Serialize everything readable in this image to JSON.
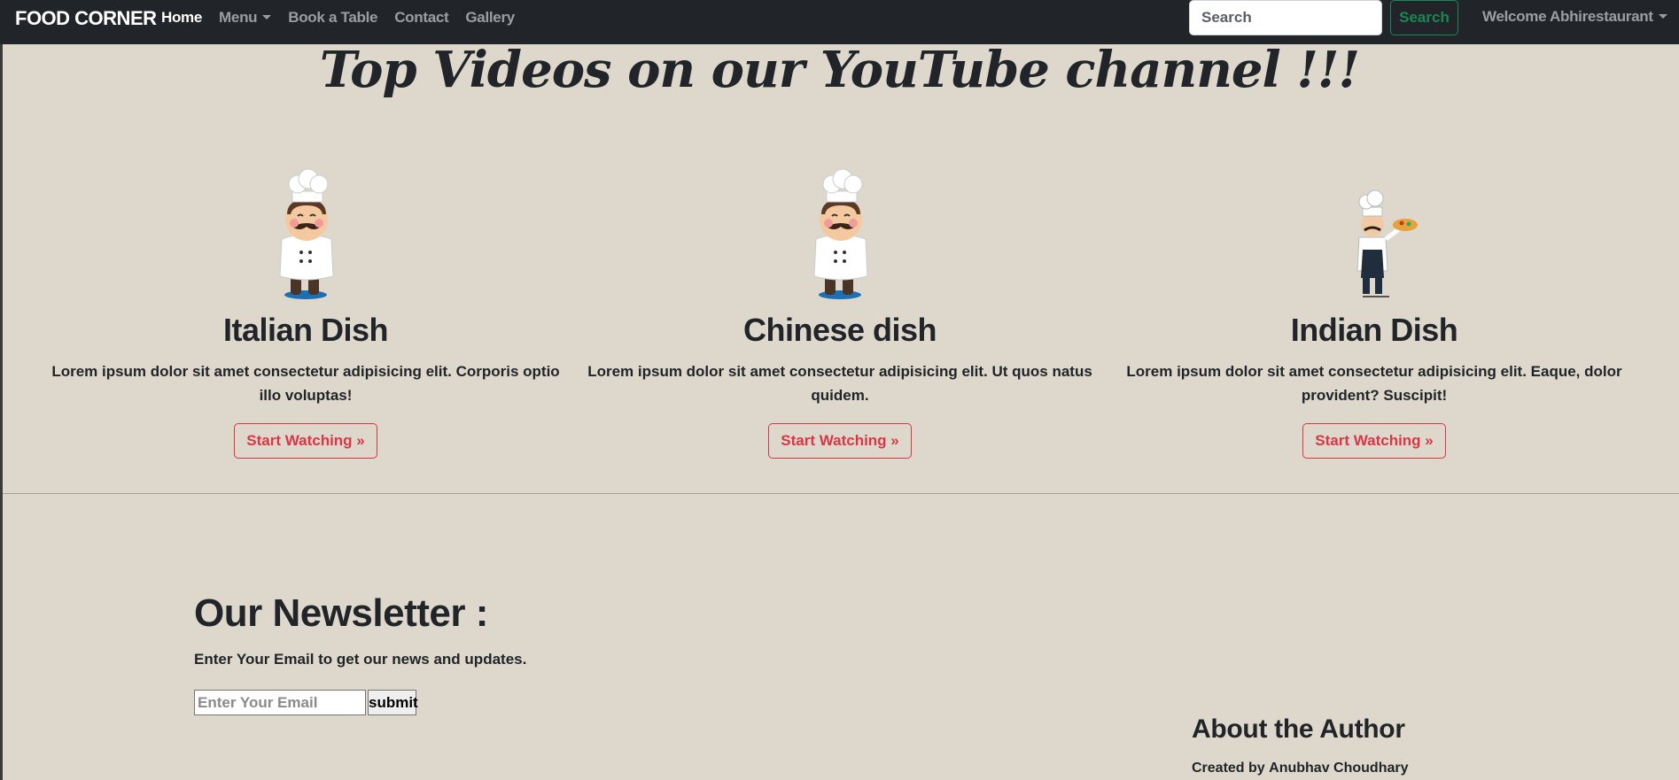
{
  "navbar": {
    "brand": "FOOD CORNER",
    "links": [
      {
        "label": "Home",
        "active": true
      },
      {
        "label": "Menu",
        "dropdown": true
      },
      {
        "label": "Book a Table"
      },
      {
        "label": "Contact"
      },
      {
        "label": "Gallery"
      }
    ],
    "search_placeholder": "Search",
    "search_button": "Search",
    "welcome": "Welcome Abhirestaurant"
  },
  "heading": "Top Videos on our YouTube channel !!!",
  "cards": [
    {
      "icon": "chef-mustache-icon",
      "title": "Italian Dish",
      "text": "Lorem ipsum dolor sit amet consectetur adipisicing elit. Corporis optio illo voluptas!",
      "button": "Start Watching »"
    },
    {
      "icon": "chef-mustache-icon",
      "title": "Chinese dish",
      "text": "Lorem ipsum dolor sit amet consectetur adipisicing elit. Ut quos natus quidem.",
      "button": "Start Watching »"
    },
    {
      "icon": "chef-pizza-icon",
      "title": "Indian Dish",
      "text": "Lorem ipsum dolor sit amet consectetur adipisicing elit. Eaque, dolor provident? Suscipit!",
      "button": "Start Watching »"
    }
  ],
  "newsletter": {
    "title": "Our Newsletter :",
    "text": "Enter Your Email to get our news and updates.",
    "input_placeholder": "Enter Your Email",
    "submit": "submit"
  },
  "about": {
    "title": "About the Author",
    "created_by": "Created by",
    "author": "Anubhav Choudhary"
  },
  "colors": {
    "navbar_bg": "#212529",
    "page_bg": "#ded8cc",
    "success": "#198754",
    "danger": "#dc3545"
  }
}
